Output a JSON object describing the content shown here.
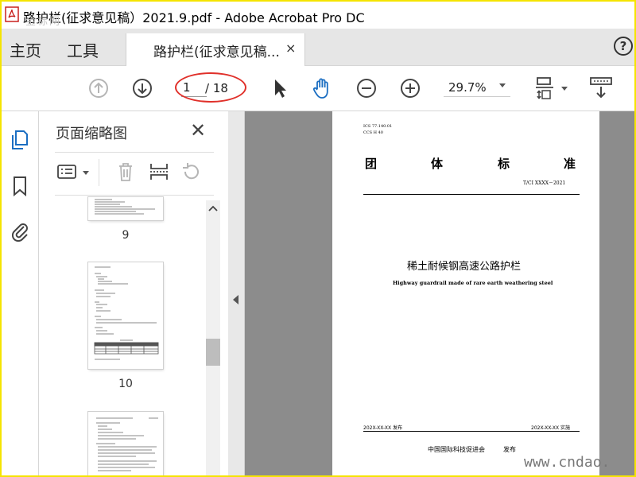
{
  "window": {
    "title": "路护栏(征求意见稿）2021.9.pdf - Adobe Acrobat Pro DC",
    "watermark_top": "金标网"
  },
  "menu": {
    "home": "主页",
    "tools": "工具",
    "doc_tab": "路护栏(征求意见稿...",
    "close": "×",
    "help": "?"
  },
  "toolbar": {
    "current_page": "1",
    "total_pages": "/ 18",
    "zoom": "29.7%"
  },
  "panel": {
    "title": "页面缩略图",
    "close": "✕",
    "thumbnails": [
      {
        "label": "9"
      },
      {
        "label": "10"
      },
      {
        "label": ""
      }
    ]
  },
  "document": {
    "ics": "ICS 77.140.01",
    "ccs": "CCS H 40",
    "header_chars": [
      "团",
      "体",
      "标",
      "准"
    ],
    "standard_no": "T/CI XXXX－2021",
    "title_cn": "稀土耐候钢高速公路护栏",
    "title_en": "Highway guardrail made of rare earth weathering steel",
    "release_date": "202X-XX-XX 发布",
    "impl_date": "202X-XX-XX 实施",
    "publisher": "中国国际科技促进会",
    "publish": "发布"
  },
  "watermark_bottom": "www.cndao."
}
